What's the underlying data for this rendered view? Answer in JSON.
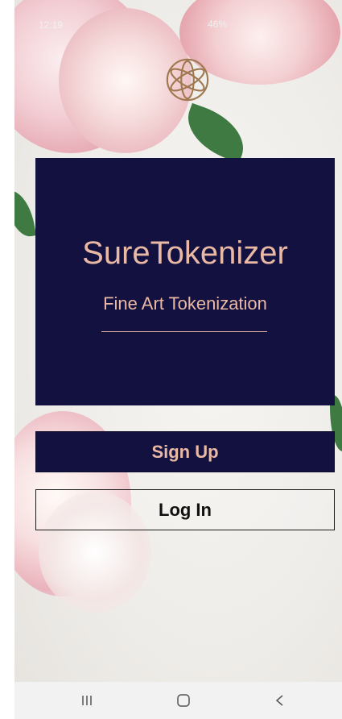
{
  "status_bar": {
    "time": "12:19",
    "battery": "46%"
  },
  "hero": {
    "title": "SureTokenizer",
    "subtitle": "Fine Art Tokenization"
  },
  "buttons": {
    "signup": "Sign Up",
    "login": "Log In"
  },
  "colors": {
    "navy": "#131140",
    "accent_text": "#eab9a5"
  },
  "nav_bar": {
    "recent_icon": "recent-apps-icon",
    "home_icon": "home-icon",
    "back_icon": "back-icon"
  }
}
